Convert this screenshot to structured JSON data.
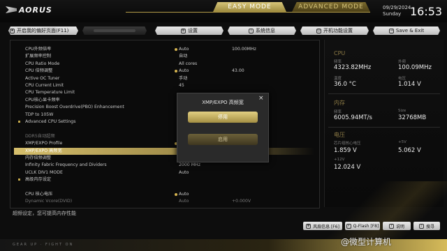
{
  "header": {
    "brand": "AORUS",
    "mode_easy": "EASY MODE",
    "mode_advanced": "ADVANCED MODE",
    "date": "09/29/2024",
    "weekday": "Sunday",
    "time": "16:53"
  },
  "nav": {
    "favorites": "开启我的偏好页面(F11)",
    "settings": "设置",
    "sysinfo": "系统信息",
    "boot": "开机功能设置",
    "save": "Save & Exit"
  },
  "settings_rows": [
    {
      "label": "CPU外频倍率",
      "dot": true,
      "v1": "Auto",
      "v2": "100.00MHz"
    },
    {
      "label": "扩展频率控制",
      "v1": "自动"
    },
    {
      "label": "CPU Ratio Mode",
      "v1": "All cores"
    },
    {
      "label": "CPU 倍频调整",
      "dot": true,
      "v1": "Auto",
      "v2": "43.00"
    },
    {
      "label": "Active OC Tuner",
      "v1": "手动"
    },
    {
      "label": "CPU Current Limit",
      "v1": "45"
    },
    {
      "label": "CPU Temperature Limit",
      "v1": ""
    },
    {
      "label": "CPU核心显卡频率",
      "v1": ""
    },
    {
      "label": "Precision Boost Overdrive(PBO) Enhancement",
      "v1": ""
    },
    {
      "label": "TDP to 105W",
      "v1": ""
    },
    {
      "label": "Advanced CPU Settings",
      "v1": "",
      "mark": true
    },
    {
      "label": "",
      "v1": ""
    },
    {
      "label": "DDR5自动超频",
      "v1": "",
      "dim": true
    },
    {
      "label": "XMP/EXPO Profile",
      "dot": true,
      "v1": "",
      "v2": "36-96-1.400V"
    },
    {
      "label": "XMP/EXPO 高频宽",
      "v1": "",
      "sel": true
    },
    {
      "label": "内存倍频调整",
      "v1": ""
    },
    {
      "label": "Infinity Fabric Frequency and Dividers",
      "v1": "2000 MHz"
    },
    {
      "label": "UCLK DIV1 MODE",
      "v1": "Auto"
    },
    {
      "label": "高级内存设定",
      "v1": "",
      "mark": true
    },
    {
      "label": "",
      "v1": ""
    },
    {
      "label": "CPU 核心电压",
      "dot": true,
      "v1": "Auto"
    },
    {
      "label": "Dynamic Vcore(DVID)",
      "v1": "Auto",
      "v2": "+0.000V",
      "dim": true
    }
  ],
  "modal": {
    "title": "XMP/EXPO 高频宽",
    "close": "×",
    "option_disable": "停用",
    "option_enable": "启用"
  },
  "sidebar": {
    "cpu_header": "CPU",
    "freq_label": "频率",
    "freq_value": "4323.82MHz",
    "bclk_label": "外频",
    "bclk_value": "100.09MHz",
    "temp_label": "温度",
    "temp_value": "36.0 °C",
    "volt_label": "电压",
    "volt_value": "1.014 V",
    "mem_header": "内存",
    "mem_freq_label": "频率",
    "mem_freq_value": "6005.94MT/s",
    "mem_size_label": "Size",
    "mem_size_value": "32768MB",
    "volt_header": "电压",
    "chipset_label": "芯片组核心电压",
    "chipset_value": "1.859 V",
    "v5_label": "+5V",
    "v5_value": "5.062 V",
    "v12_label": "+12V",
    "v12_value": "12.024 V"
  },
  "help_text": "超频设定，您可提高内存性能",
  "bottom_buttons": {
    "fan": "风扇信息 [F6]",
    "qflash": "Q-Flash [F8]",
    "help": "说明",
    "search": "搜寻"
  },
  "footer_text": "GEAR UP · FIGHT ON",
  "watermark": "@微型计算机",
  "colors": {
    "gold": "#d4b34f",
    "selected_row": "#d6bf6c"
  }
}
